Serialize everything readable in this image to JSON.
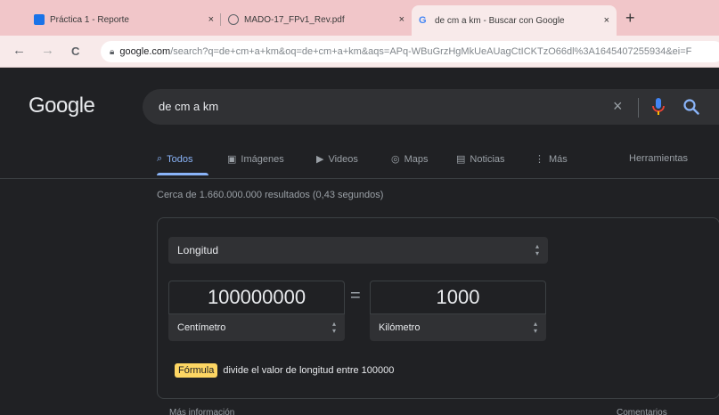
{
  "browser": {
    "tabs": [
      {
        "title": "Práctica 1 - Reporte",
        "favicon_color": "#1a73e8"
      },
      {
        "title": "MADO-17_FPv1_Rev.pdf",
        "favicon_color": "#5f6368"
      },
      {
        "title": "de cm a km - Buscar con Google",
        "favicon_color": "#4285f4"
      }
    ],
    "tab_close_glyph": "×",
    "new_tab_glyph": "+",
    "nav": {
      "back": "←",
      "forward": "→",
      "reload": "C"
    },
    "url_host": "google.com",
    "url_path": "/search?q=de+cm+a+km&oq=de+cm+a+km&aqs=APq-WBuGrzHgMkUeAUagCtICKTzO66dl%3A1645407255934&ei=F"
  },
  "google": {
    "logo": "Google",
    "query": "de cm a km",
    "clear_glyph": "×",
    "tabs": [
      {
        "label": "Todos",
        "icon": "search-icon",
        "glyph": "⌕"
      },
      {
        "label": "Imágenes",
        "icon": "image-icon",
        "glyph": "▣"
      },
      {
        "label": "Videos",
        "icon": "video-icon",
        "glyph": "▶"
      },
      {
        "label": "Maps",
        "icon": "map-pin-icon",
        "glyph": "◎"
      },
      {
        "label": "Noticias",
        "icon": "news-icon",
        "glyph": "▤"
      },
      {
        "label": "Más",
        "icon": "more-icon",
        "glyph": "⋮"
      }
    ],
    "tools": "Herramientas",
    "stats": "Cerca de 1.660.000.000 resultados (0,43 segundos)",
    "converter": {
      "kind": "Longitud",
      "from_value": "100000000",
      "to_value": "1000",
      "equals": "=",
      "from_unit": "Centímetro",
      "to_unit": "Kilómetro",
      "formula_badge": "Fórmula",
      "formula_text": "divide el valor de longitud entre 100000"
    },
    "more_info": "Más información",
    "feedback": "Comentarios"
  },
  "colors": {
    "accent": "#8ab4f8",
    "tabstrip": "#f1c6c9",
    "page_bg": "#202124",
    "formula_badge": "#fdd663"
  }
}
